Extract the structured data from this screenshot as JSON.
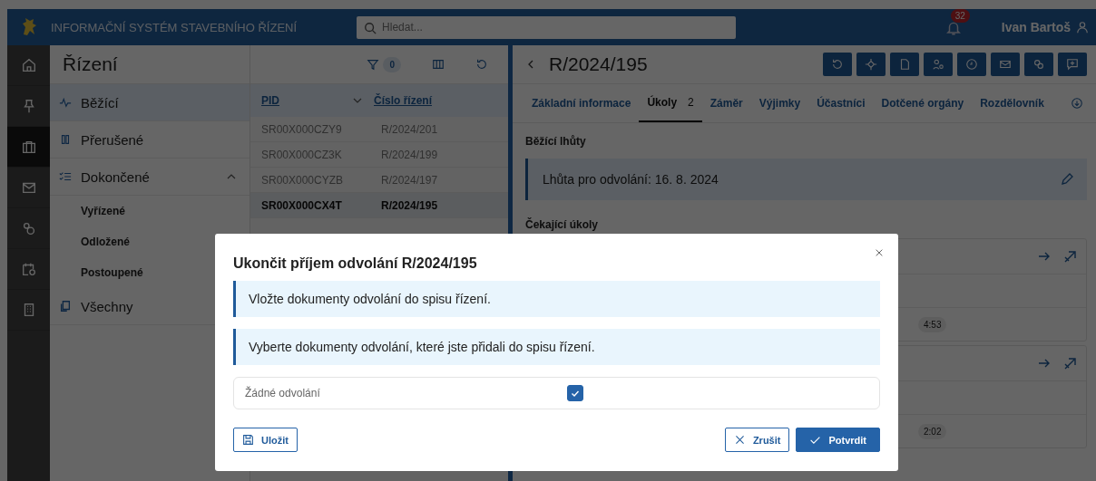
{
  "header": {
    "app_title": "INFORMAČNÍ SYSTÉM STAVEBNÍHO ŘÍZENÍ",
    "search": {
      "placeholder": "Hledat..."
    },
    "notifications": "32",
    "user": "Ivan Bartoš"
  },
  "rail": [
    {
      "kind": "home",
      "selected": false
    },
    {
      "kind": "pin",
      "selected": false
    },
    {
      "kind": "briefcase",
      "selected": true
    },
    {
      "kind": "mail",
      "selected": false
    },
    {
      "kind": "coins",
      "selected": false
    },
    {
      "kind": "calendar",
      "selected": false
    },
    {
      "kind": "building",
      "selected": false
    }
  ],
  "sidebar": {
    "title": "Řízení",
    "items": [
      {
        "label": "Běžící",
        "kind": "pulse",
        "selected": true
      },
      {
        "label": "Přerušené",
        "kind": "pause",
        "selected": false
      },
      {
        "label": "Dokončené",
        "kind": "checklist",
        "selected": false,
        "expanded": true,
        "children": [
          {
            "label": "Vyřízené"
          },
          {
            "label": "Odložené"
          },
          {
            "label": "Postoupené"
          }
        ]
      },
      {
        "label": "Všechny",
        "kind": "copy",
        "selected": false
      }
    ]
  },
  "list": {
    "filter_count": "0",
    "columns": [
      "PID",
      "Číslo řízení"
    ],
    "rows": [
      {
        "pid": "SR00X000CZY9",
        "number": "R/2024/201",
        "selected": false
      },
      {
        "pid": "SR00X000CZ3K",
        "number": "R/2024/199",
        "selected": false
      },
      {
        "pid": "SR00X000CYZB",
        "number": "R/2024/197",
        "selected": false
      },
      {
        "pid": "SR00X000CX4T",
        "number": "R/2024/195",
        "selected": true
      }
    ]
  },
  "detail": {
    "title": "R/2024/195",
    "tabs": [
      {
        "label": "Základní informace",
        "selected": false
      },
      {
        "label": "Úkoly",
        "count": "2",
        "selected": true
      },
      {
        "label": "Záměr",
        "selected": false
      },
      {
        "label": "Výjimky",
        "selected": false
      },
      {
        "label": "Účastníci",
        "selected": false
      },
      {
        "label": "Dotčené orgány",
        "selected": false
      },
      {
        "label": "Rozdělovník",
        "selected": false
      }
    ],
    "running_heading": "Běžící lhůty",
    "deadline": "Lhůta pro odvolání: 16. 8. 2024",
    "waiting_heading": "Čekající úkoly",
    "tasks": [
      {
        "time": "4:53"
      },
      {
        "time": "2:02"
      }
    ]
  },
  "modal": {
    "title": "Ukončit příjem odvolání R/2024/195",
    "infos": [
      "Vložte dokumenty odvolání do spisu řízení.",
      "Vyberte dokumenty odvolání, které jste přidali do spisu řízení."
    ],
    "option": {
      "label": "Žádné odvolání",
      "checked": true
    },
    "buttons": [
      {
        "label": "Uložit",
        "kind": "save"
      },
      {
        "label": "Zrušit",
        "kind": "cancel"
      },
      {
        "label": "Potvrdit",
        "kind": "confirm"
      }
    ]
  }
}
